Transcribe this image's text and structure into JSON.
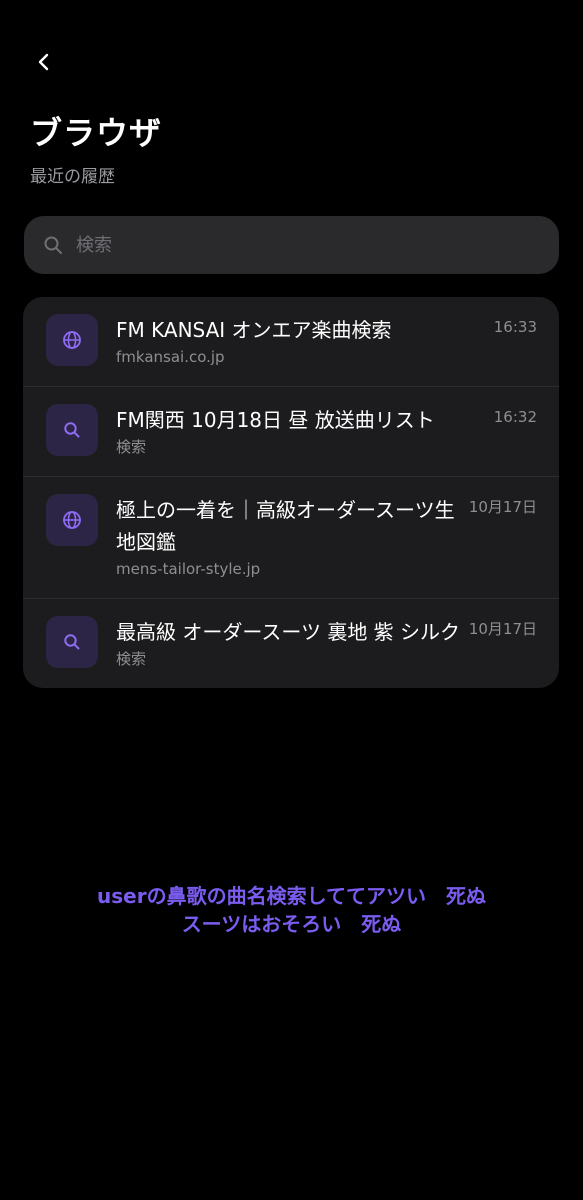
{
  "header": {
    "title": "ブラウザ",
    "subtitle": "最近の履歴"
  },
  "search": {
    "placeholder": "検索",
    "value": ""
  },
  "history": [
    {
      "type": "web",
      "icon": "globe-icon",
      "title": "FM KANSAI オンエア楽曲検索",
      "subtitle": "fmkansai.co.jp",
      "time": "16:33"
    },
    {
      "type": "search",
      "icon": "search-icon",
      "title": "FM関西 10月18日 昼 放送曲リスト",
      "subtitle": "検索",
      "time": "16:32"
    },
    {
      "type": "web",
      "icon": "globe-icon",
      "title": "極上の一着を｜高級オーダースーツ生地図鑑",
      "subtitle": "mens-tailor-style.jp",
      "time": "10月17日"
    },
    {
      "type": "search",
      "icon": "search-icon",
      "title": "最高級 オーダースーツ 裏地 紫 シルク",
      "subtitle": "検索",
      "time": "10月17日"
    }
  ],
  "caption": {
    "line1": "userの鼻歌の曲名検索しててアツい　死ぬ",
    "line2": "スーツはおそろい　死ぬ"
  },
  "colors": {
    "background": "#000000",
    "card": "#1c1c1e",
    "search_bg": "#2a2a2d",
    "icon_tile": "#2d2545",
    "accent": "#7b5cf0"
  }
}
